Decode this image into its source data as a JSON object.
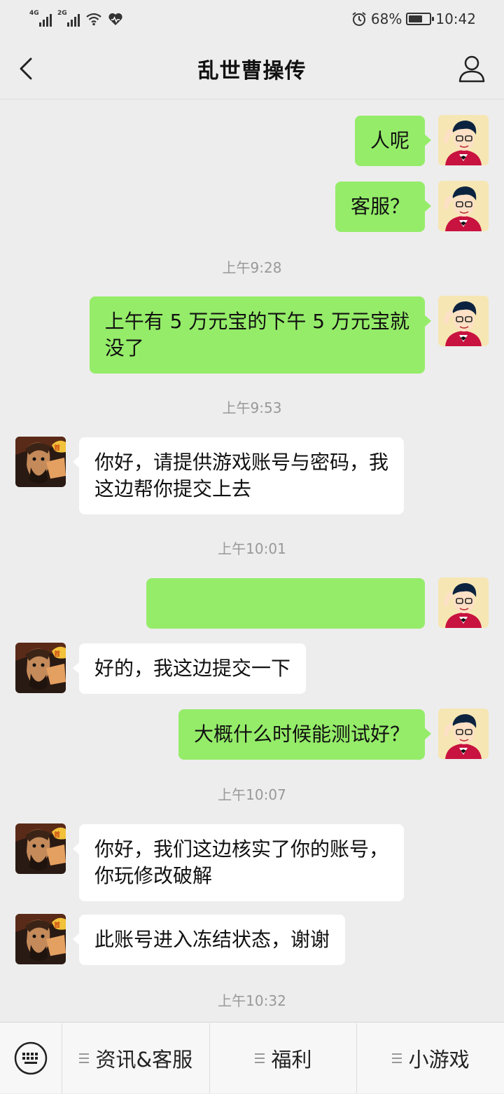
{
  "status_bar": {
    "sim1_tag": "4G",
    "sim2_tag": "2G",
    "battery_percent": "68%",
    "battery_level": 0.68,
    "time": "10:42"
  },
  "nav": {
    "title": "乱世曹操传"
  },
  "messages": [
    {
      "from": "me",
      "text": "人呢"
    },
    {
      "from": "me",
      "text": "客服？"
    },
    {
      "timestamp": "上午9:28"
    },
    {
      "from": "me",
      "text": "上午有 5 万元宝的下午 5 万元宝就\n没了"
    },
    {
      "timestamp": "上午9:53"
    },
    {
      "from": "them",
      "text": "你好，请提供游戏账号与密码，我\n这边帮你提交上去"
    },
    {
      "timestamp": "上午10:01"
    },
    {
      "from": "me",
      "redacted": true
    },
    {
      "from": "them",
      "text": "好的，我这边提交一下"
    },
    {
      "from": "me",
      "text": "大概什么时候能测试好？"
    },
    {
      "timestamp": "上午10:07"
    },
    {
      "from": "them",
      "text": "你好，我们这边核实了你的账号，\n你玩修改破解"
    },
    {
      "from": "them",
      "text": "此账号进入冻结状态，谢谢"
    },
    {
      "timestamp": "上午10:32"
    }
  ],
  "bottom_menu": {
    "items": [
      "资讯&客服",
      "福利",
      "小游戏"
    ]
  },
  "colors": {
    "background": "#ededed",
    "my_bubble": "#95ec69",
    "their_bubble": "#ffffff",
    "timestamp_text": "#999999"
  },
  "icons": [
    "back-chevron-icon",
    "profile-icon",
    "keyboard-icon",
    "menu-lines-icon",
    "alarm-icon",
    "wifi-icon",
    "heart-icon",
    "battery-icon"
  ]
}
